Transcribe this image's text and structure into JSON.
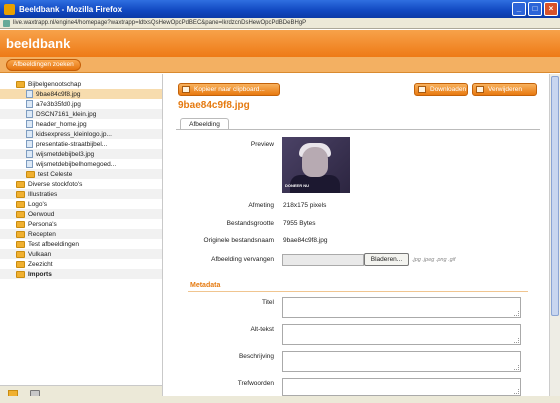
{
  "window": {
    "title": "Beeldbank - Mozilla Firefox"
  },
  "address_bar": {
    "url": "live.waxtrapp.nl/engine4/homepage?waxtrapp=ldtxsQsHewOpcPdBEC&pane=lkrdzcnDsHewOpcPdBDeBHgP"
  },
  "app": {
    "title": "beeldbank",
    "search_images_label": "Afbeeldingen zoeken"
  },
  "tree": [
    {
      "label": "Bijbelgenootschap",
      "kind": "folder",
      "level": 1
    },
    {
      "label": "9bae84c9f8.jpg",
      "kind": "file",
      "level": 2,
      "selected": true
    },
    {
      "label": "a7e3b35fd0.jpg",
      "kind": "file",
      "level": 2
    },
    {
      "label": "DSCN7161_klein.jpg",
      "kind": "file",
      "level": 2
    },
    {
      "label": "header_home.jpg",
      "kind": "file",
      "level": 2
    },
    {
      "label": "kidsexpress_kleinlogo.jp...",
      "kind": "file",
      "level": 2
    },
    {
      "label": "presentatie-straatbijbel...",
      "kind": "file",
      "level": 2
    },
    {
      "label": "wijsmetdebijbel3.jpg",
      "kind": "file",
      "level": 2
    },
    {
      "label": "wijsmetdebijbelhomegoed...",
      "kind": "file",
      "level": 2
    },
    {
      "label": "test Celeste",
      "kind": "folder",
      "level": 2
    },
    {
      "label": "Diverse stockfoto's",
      "kind": "folder",
      "level": 1
    },
    {
      "label": "Illustraties",
      "kind": "folder",
      "level": 1
    },
    {
      "label": "Logo's",
      "kind": "folder",
      "level": 1
    },
    {
      "label": "Oerwoud",
      "kind": "folder",
      "level": 1
    },
    {
      "label": "Persona's",
      "kind": "folder",
      "level": 1
    },
    {
      "label": "Recepten",
      "kind": "folder",
      "level": 1
    },
    {
      "label": "Test afbeeldingen",
      "kind": "folder",
      "level": 1
    },
    {
      "label": "Vulkaan",
      "kind": "folder",
      "level": 1
    },
    {
      "label": "Zeezicht",
      "kind": "folder",
      "level": 1
    },
    {
      "label": "Imports",
      "kind": "folder",
      "level": 1,
      "bold": true
    }
  ],
  "toolbar": {
    "copy_label": "Kopieer naar clipboard...",
    "download_label": "Downloaden",
    "delete_label": "Verwijderen"
  },
  "detail": {
    "filename": "9bae84c9f8.jpg",
    "tab_label": "Afbeelding",
    "preview_label": "Preview",
    "preview_caption": "DONEER NU",
    "fields": {
      "size_label": "Afmeting",
      "size_value": "218x175 pixels",
      "filesize_label": "Bestandsgrootte",
      "filesize_value": "7955 Bytes",
      "origname_label": "Originele bestandsnaam",
      "origname_value": "9bae84c9f8.jpg",
      "replace_label": "Afbeelding vervangen"
    },
    "browse_label": "Bladeren...",
    "allowed_extensions": ".jpg .jpeg .png .gif"
  },
  "metadata": {
    "title": "Metadata",
    "fields": [
      {
        "label": "Titel",
        "value": ""
      },
      {
        "label": "Alt-tekst",
        "value": ""
      },
      {
        "label": "Beschrijving",
        "value": ""
      },
      {
        "label": "Trefwoorden",
        "value": ""
      }
    ]
  }
}
